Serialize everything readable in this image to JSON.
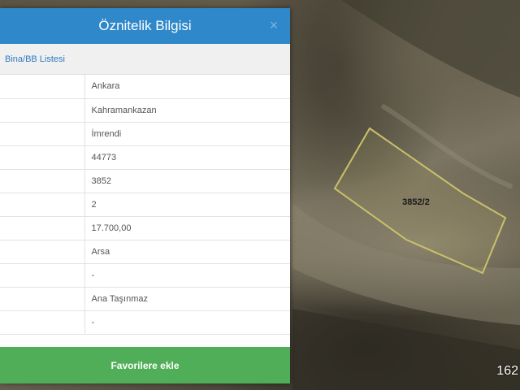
{
  "dialog": {
    "title": "Öznitelik Bilgisi",
    "close_icon": "×",
    "subnav_link": "Bina/BB Listesi",
    "rows": [
      {
        "key": "",
        "value": "Ankara"
      },
      {
        "key": "",
        "value": "Kahramankazan"
      },
      {
        "key": "",
        "value": "İmrendi"
      },
      {
        "key": "",
        "value": "44773"
      },
      {
        "key": "",
        "value": "3852"
      },
      {
        "key": "",
        "value": "2"
      },
      {
        "key": "",
        "value": "17.700,00"
      },
      {
        "key": "",
        "value": "Arsa"
      },
      {
        "key": "",
        "value": "-"
      },
      {
        "key": "",
        "value": "Ana Taşınmaz"
      },
      {
        "key": "",
        "value": "-"
      }
    ],
    "action_button": "Favorilere ekle"
  },
  "map": {
    "parcel_label": "3852/2",
    "corner_number": "162"
  },
  "colors": {
    "header": "#2e88c9",
    "action": "#4fae57",
    "parcel_outline": "#c9c06a"
  }
}
